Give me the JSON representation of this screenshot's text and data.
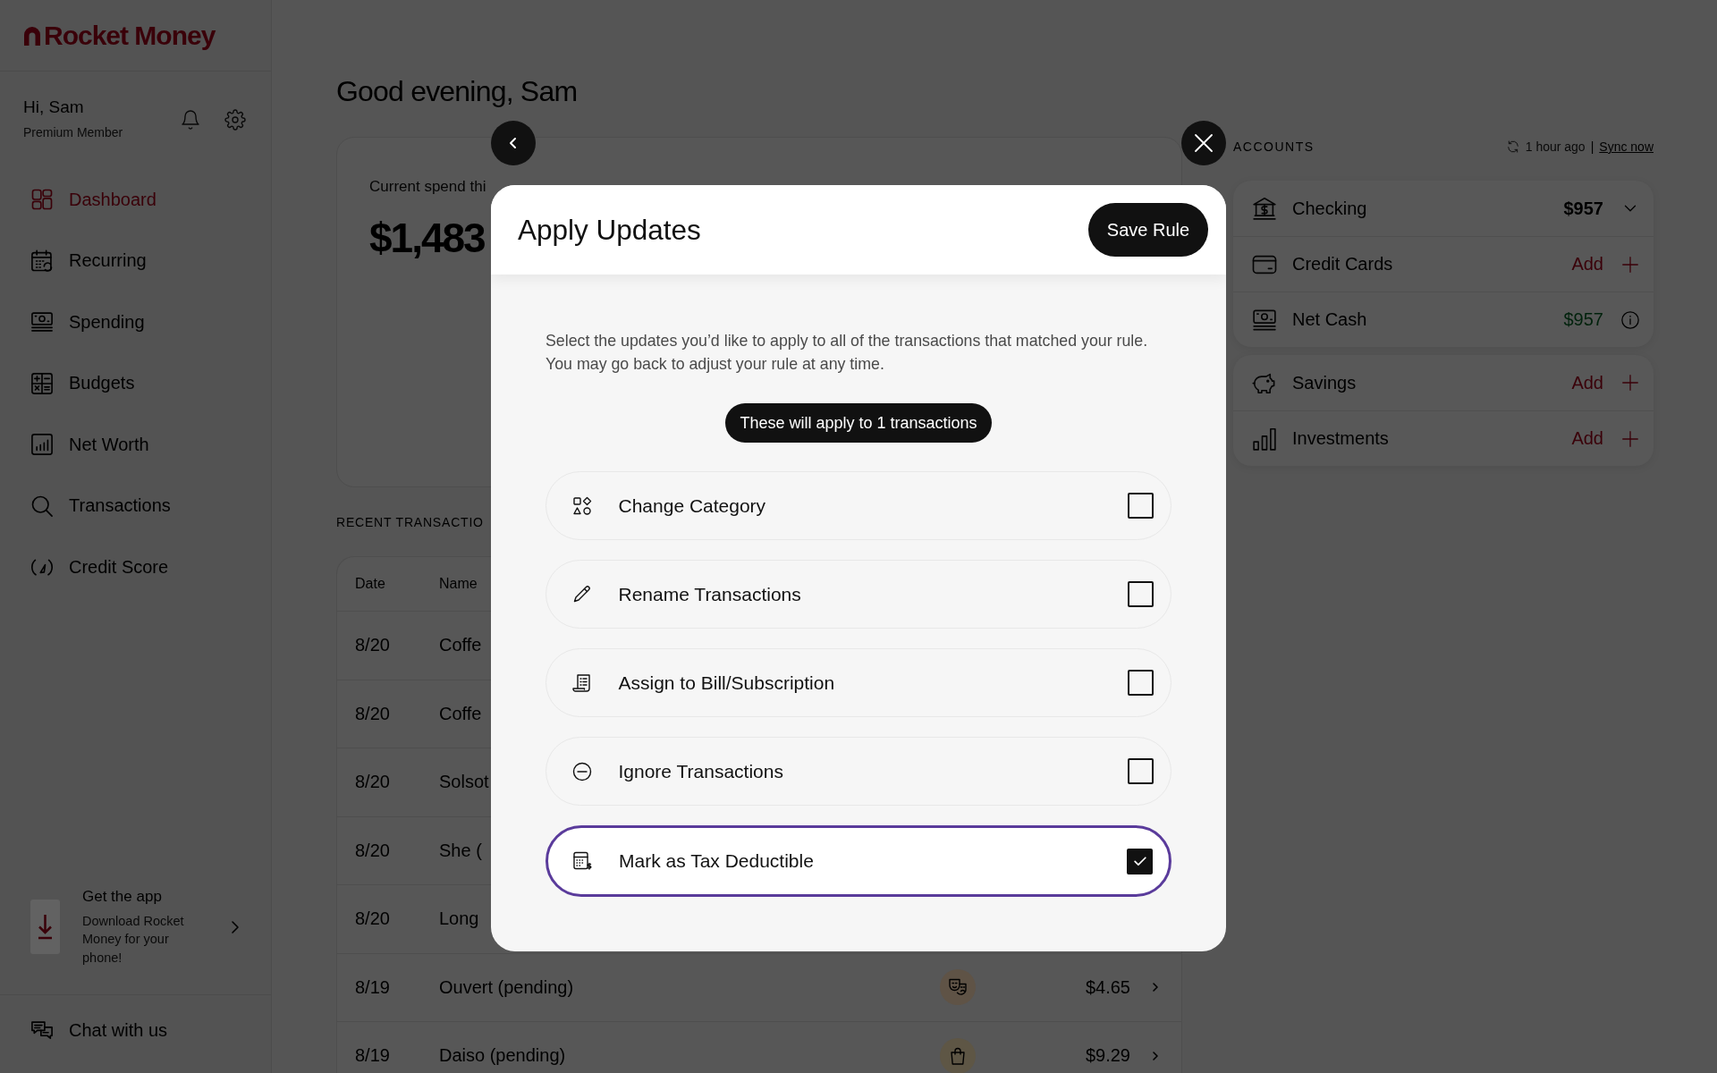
{
  "sidebar": {
    "logo": "Rocket Money",
    "greeting": "Hi, Sam",
    "membership": "Premium Member",
    "nav": [
      {
        "label": "Dashboard",
        "selected": true
      },
      {
        "label": "Recurring",
        "selected": false
      },
      {
        "label": "Spending",
        "selected": false
      },
      {
        "label": "Budgets",
        "selected": false
      },
      {
        "label": "Net Worth",
        "selected": false
      },
      {
        "label": "Transactions",
        "selected": false
      },
      {
        "label": "Credit Score",
        "selected": false
      }
    ],
    "promo": {
      "title": "Get the app",
      "text": "Download Rocket Money for your phone!"
    },
    "chat": "Chat with us"
  },
  "dashboard": {
    "greeting": "Good evening, Sam",
    "spend": {
      "label": "Current spend thi",
      "amount": "$1,483"
    },
    "recent": {
      "title": "RECENT TRANSACTIO",
      "columns": [
        "Date",
        "Name"
      ],
      "rows": [
        {
          "date": "8/20",
          "name": "Coffe"
        },
        {
          "date": "8/20",
          "name": "Coffe"
        },
        {
          "date": "8/20",
          "name": "Solsot"
        },
        {
          "date": "8/20",
          "name": "She ("
        },
        {
          "date": "8/20",
          "name": "Long"
        },
        {
          "date": "8/19",
          "name": "Ouvert (pending)",
          "kind": "entertainment",
          "amount": "$4.65"
        },
        {
          "date": "8/19",
          "name": "Daiso (pending)",
          "kind": "shopping",
          "amount": "$9.29"
        }
      ]
    }
  },
  "accounts": {
    "title": "ACCOUNTS",
    "synced": "1 hour ago",
    "separator": "|",
    "sync_link": "Sync now",
    "groups": [
      [
        {
          "name": "Checking",
          "kind": "balance",
          "value": "$957"
        },
        {
          "name": "Credit Cards",
          "kind": "add",
          "value": "Add"
        },
        {
          "name": "Net Cash",
          "kind": "net",
          "value": "$957"
        }
      ],
      [
        {
          "name": "Savings",
          "kind": "add",
          "value": "Add"
        },
        {
          "name": "Investments",
          "kind": "add",
          "value": "Add"
        }
      ]
    ]
  },
  "modal": {
    "title": "Apply Updates",
    "save": "Save Rule",
    "description": "Select the updates you’d like to apply to all of the transactions that matched your rule. You may go back to adjust your rule at any time.",
    "count": "These will apply to 1 transactions",
    "options": [
      {
        "label": "Change Category",
        "checked": false
      },
      {
        "label": "Rename Transactions",
        "checked": false
      },
      {
        "label": "Assign to Bill/Subscription",
        "checked": false
      },
      {
        "label": "Ignore Transactions",
        "checked": false
      },
      {
        "label": "Mark as Tax Deductible",
        "checked": true
      }
    ]
  }
}
